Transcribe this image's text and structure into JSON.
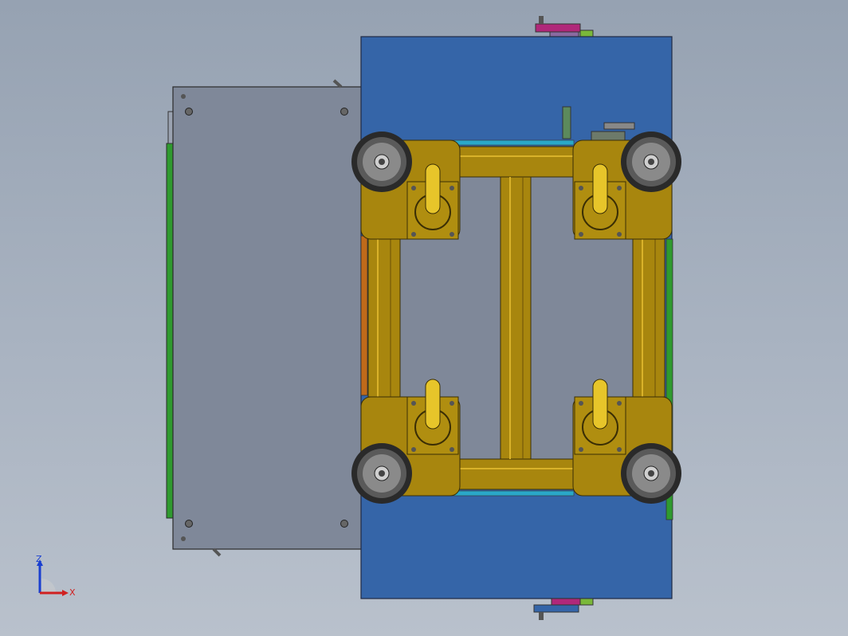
{
  "app": {
    "window_title": ""
  },
  "viewport": {
    "background_top": "#96a2b2",
    "background_bottom": "#b9c1cc",
    "colors": {
      "frame": "#a8860e",
      "frame_light": "#c9a420",
      "frame_dark": "#6a5008",
      "blue_plate": "#3565a8",
      "grey_panel": "#7f8899",
      "green_edge": "#2f9a2f",
      "magenta": "#b0287a",
      "tire": "#2a2a2a",
      "cyan": "#2aa8c8"
    },
    "icons": [
      "wheel-icon",
      "caster-icon",
      "bolt-icon",
      "gear-icon"
    ]
  },
  "triad": {
    "x_label": "X",
    "z_label": "Z",
    "x_color": "#d02020",
    "z_color": "#1a3fd0"
  }
}
